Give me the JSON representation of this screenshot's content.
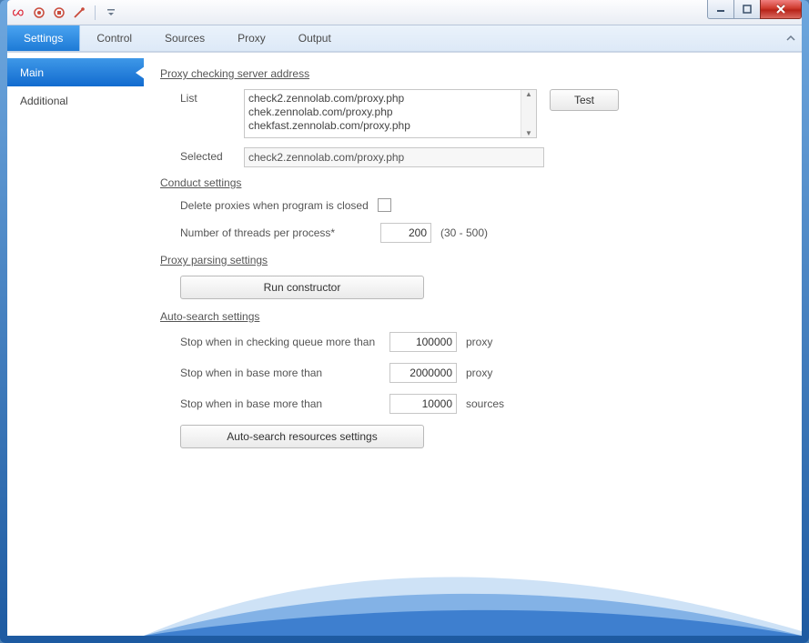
{
  "ribbon": {
    "tabs": [
      "Settings",
      "Control",
      "Sources",
      "Proxy",
      "Output"
    ],
    "active": 0
  },
  "sidebar": {
    "items": [
      "Main",
      "Additional"
    ],
    "active": 0
  },
  "proxy_checking": {
    "title": "Proxy checking server address",
    "list_label": "List",
    "list_items": [
      "check2.zennolab.com/proxy.php",
      "chek.zennolab.com/proxy.php",
      "chekfast.zennolab.com/proxy.php"
    ],
    "selected_label": "Selected",
    "selected_value": "check2.zennolab.com/proxy.php",
    "test_button": "Test"
  },
  "conduct": {
    "title": "Conduct settings",
    "delete_label": "Delete proxies when program is closed",
    "delete_checked": false,
    "threads_label": "Number of threads per process*",
    "threads_value": "200",
    "threads_hint": "(30 - 500)"
  },
  "parsing": {
    "title": "Proxy parsing settings",
    "run_button": "Run constructor"
  },
  "autosearch": {
    "title": "Auto-search settings",
    "rows": [
      {
        "label": "Stop when in checking queue more than",
        "value": "100000",
        "unit": "proxy"
      },
      {
        "label": "Stop when in base more than",
        "value": "2000000",
        "unit": "proxy"
      },
      {
        "label": "Stop when in base more than",
        "value": "10000",
        "unit": "sources"
      }
    ],
    "resources_button": "Auto-search resources settings"
  }
}
